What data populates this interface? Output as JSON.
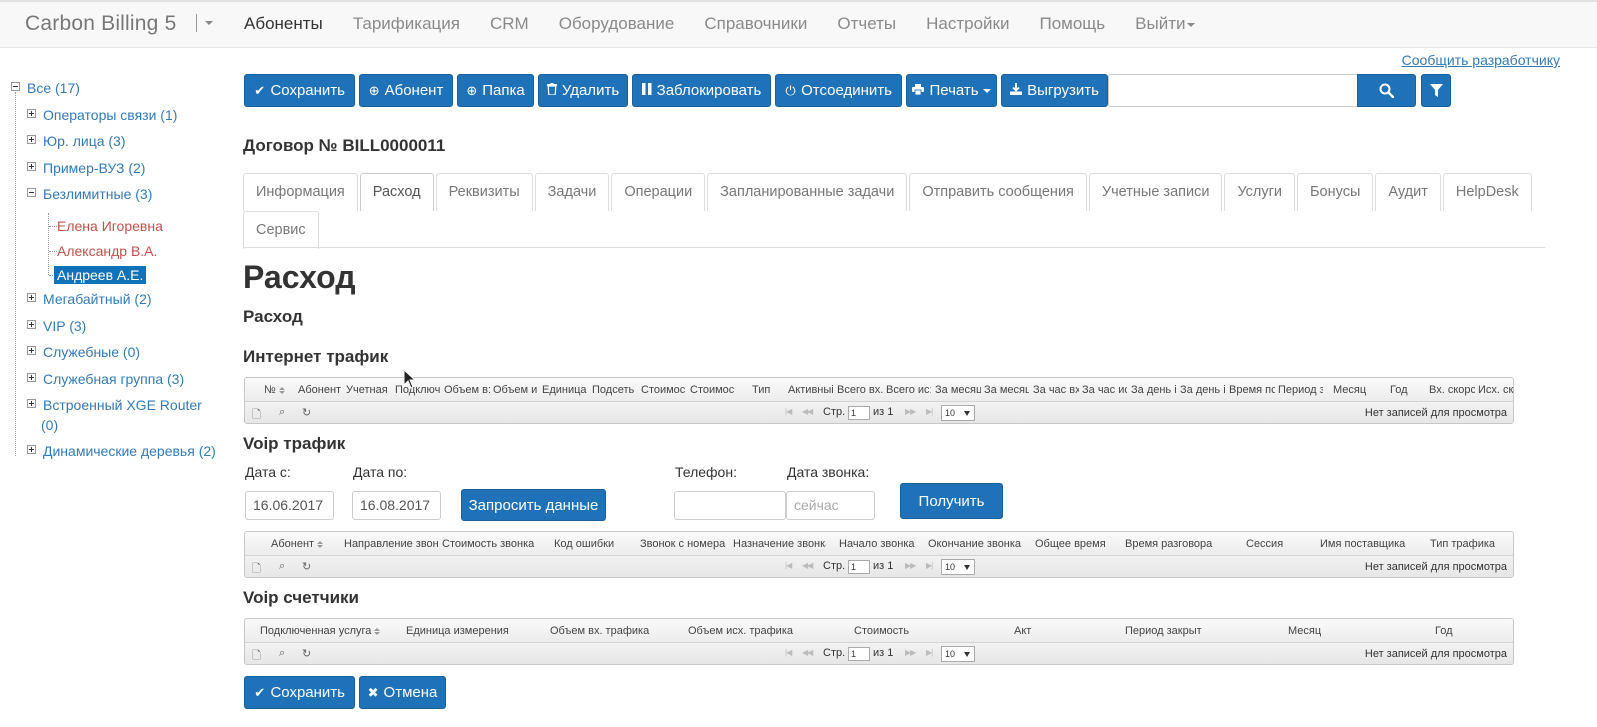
{
  "navbar": {
    "brand": "Carbon Billing 5",
    "items": [
      {
        "label": "Абоненты",
        "active": true
      },
      {
        "label": "Тарификация"
      },
      {
        "label": "CRM"
      },
      {
        "label": "Оборудование"
      },
      {
        "label": "Справочники"
      },
      {
        "label": "Отчеты"
      },
      {
        "label": "Настройки"
      },
      {
        "label": "Помощь"
      },
      {
        "label": "Выйти",
        "dropdown": true
      }
    ]
  },
  "report_link": "Сообщить разработчику",
  "tree": [
    {
      "label": "Все (17)"
    },
    {
      "label": "Операторы связи (1)"
    },
    {
      "label": "Юр. лица (3)"
    },
    {
      "label": "Пример-ВУЗ (2)"
    },
    {
      "label": "Безлимитные (3)"
    },
    {
      "label": "Елена Игоревна"
    },
    {
      "label": "Александр В.А."
    },
    {
      "label": "Андреев А.Е."
    },
    {
      "label": "Мегабайтный (2)"
    },
    {
      "label": "VIP (3)"
    },
    {
      "label": "Служебные (0)"
    },
    {
      "label": "Служебная группа (3)"
    },
    {
      "label": "Встроенный XGE Router"
    },
    {
      "label": "(0)"
    },
    {
      "label": "Динамические деревья (2)"
    }
  ],
  "toolbar": {
    "save": "Сохранить",
    "subscriber": "Абонент",
    "folder": "Папка",
    "delete": "Удалить",
    "block": "Заблокировать",
    "disconnect": "Отсоединить",
    "print": "Печать",
    "export": "Выгрузить",
    "search_value": ""
  },
  "contract_title": "Договор № BILL0000011",
  "tabs": [
    "Информация",
    "Расход",
    "Реквизиты",
    "Задачи",
    "Операции",
    "Запланированные задачи",
    "Отправить сообщения",
    "Учетные записи",
    "Услуги",
    "Бонусы",
    "Аудит",
    "HelpDesk",
    "Сервис"
  ],
  "active_tab": "Расход",
  "page_heading": "Расход",
  "sub_heading": "Расход",
  "internet": {
    "title": "Интернет трафик",
    "columns": [
      "№",
      "Абонент",
      "Учетная",
      "Подключ",
      "Объем в:",
      "Объем и:",
      "Единица",
      "Подсеть",
      "Стоимос",
      "Стоимос",
      "Тип",
      "Активныі",
      "Всего вх.",
      "Всего ис:",
      "За месяц",
      "За месяц",
      "За час вх",
      "За час ис",
      "За день і",
      "За день і",
      "Время пс",
      "Период з",
      "Месяц",
      "Год",
      "Вх. скорс",
      "Исх. ск"
    ]
  },
  "pager": {
    "page_label": "Стр.",
    "page_value": "1",
    "of_label": "из 1",
    "rows": "10",
    "empty": "Нет записей для просмотра"
  },
  "voip": {
    "title": "Voip трафик",
    "date_from_label": "Дата с:",
    "date_from": "16.06.2017",
    "date_to_label": "Дата по:",
    "date_to": "16.08.2017",
    "request_button": "Запросить данные",
    "phone_label": "Телефон:",
    "phone_value": "",
    "call_date_label": "Дата звонка:",
    "call_date_placeholder": "сейчас",
    "get_button": "Получить",
    "columns": [
      "Абонент",
      "Направление звон",
      "Стоимость звонка",
      "Код ошибки",
      "Звонок с номера",
      "Назначение звонка",
      "Начало звонка",
      "Окончание звонка",
      "Общее время",
      "Время разговора",
      "Сессия",
      "Имя поставщика",
      "Тип трафика"
    ]
  },
  "voip_counters": {
    "title": "Voip счетчики",
    "columns": [
      "Подключенная услуга",
      "Единица измерения",
      "Объем вх. трафика",
      "Объем исх. трафика",
      "Стоимость",
      "Акт",
      "Период закрыт",
      "Месяц",
      "Год"
    ]
  },
  "footer": {
    "save": "Сохранить",
    "cancel": "Отмена"
  },
  "colors": {
    "primary": "#1f72b8",
    "link": "#337ab7",
    "tree_red": "#c0504d",
    "tree_selected": "#1073b9"
  }
}
